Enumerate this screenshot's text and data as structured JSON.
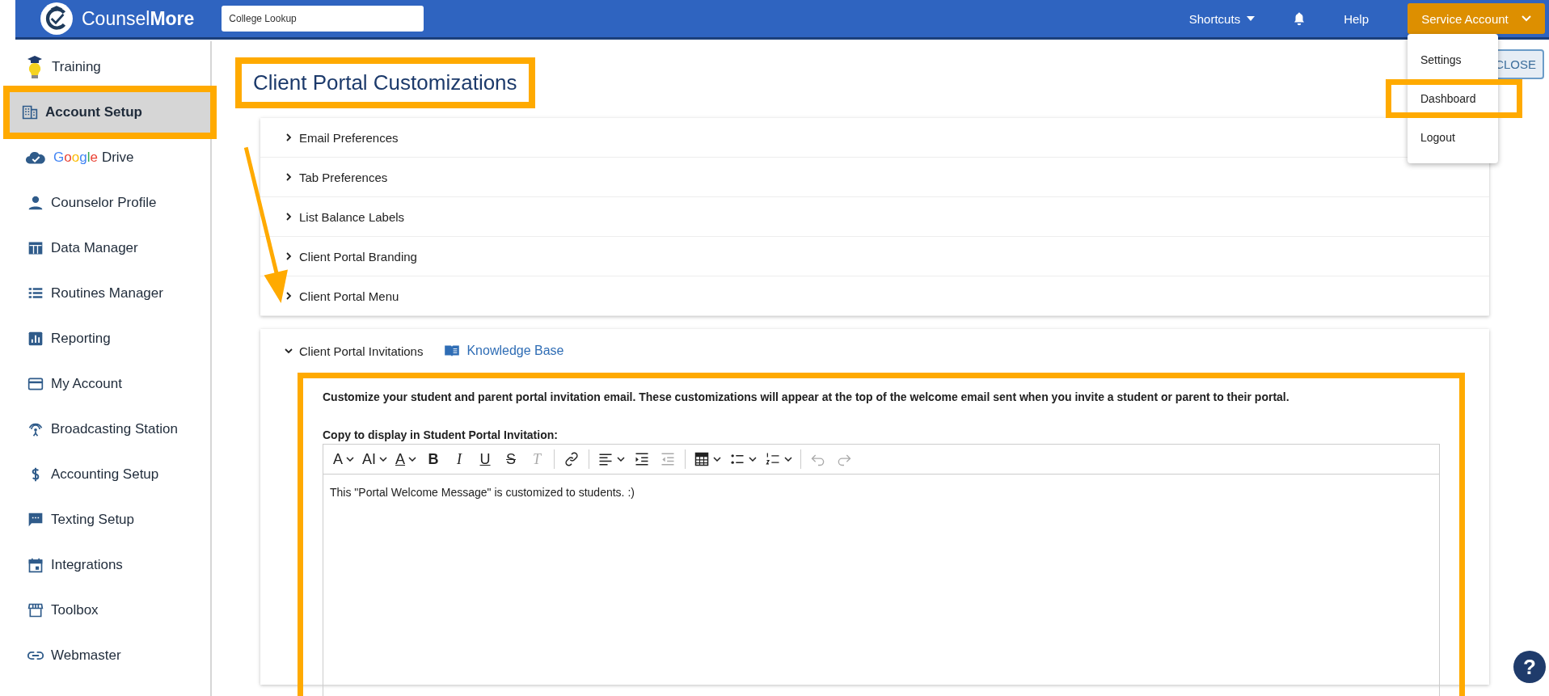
{
  "header": {
    "logo_text": "Counsel**More**",
    "search": {
      "placeholder": "College Lookup"
    },
    "shortcuts": "Shortcuts",
    "help": "Help",
    "account": "Service Account"
  },
  "account_menu": {
    "open": true,
    "items": [
      {
        "label": "Settings",
        "highlighted": false
      },
      {
        "label": "Dashboard",
        "highlighted": true
      },
      {
        "label": "Logout",
        "highlighted": false
      }
    ]
  },
  "sidebar": {
    "items": [
      {
        "label": "Training",
        "selected": false,
        "highlighted": false
      },
      {
        "label": "Account Setup",
        "selected": true,
        "highlighted": true
      },
      {
        "brand": "Google",
        "label": "Drive",
        "selected": false,
        "highlighted": false
      },
      {
        "label": "Counselor Profile",
        "selected": false,
        "highlighted": false
      },
      {
        "label": "Data Manager",
        "selected": false,
        "highlighted": false
      },
      {
        "label": "Routines Manager",
        "selected": false,
        "highlighted": false
      },
      {
        "label": "Reporting",
        "selected": false,
        "highlighted": false
      },
      {
        "label": "My Account",
        "selected": false,
        "highlighted": false
      },
      {
        "label": "Broadcasting Station",
        "selected": false,
        "highlighted": false
      },
      {
        "label": "Accounting Setup",
        "selected": false,
        "highlighted": false
      },
      {
        "label": "Texting Setup",
        "selected": false,
        "highlighted": false
      },
      {
        "label": "Integrations",
        "selected": false,
        "highlighted": false
      },
      {
        "label": "Toolbox",
        "selected": false,
        "highlighted": false
      },
      {
        "label": "Webmaster",
        "selected": false,
        "highlighted": false
      }
    ]
  },
  "page": {
    "title": "Client Portal Customizations",
    "title_highlighted": true,
    "close_button": "CLOSE",
    "sections": [
      {
        "label": "Email Preferences",
        "expanded": false
      },
      {
        "label": "Tab Preferences",
        "expanded": false
      },
      {
        "label": "List Balance Labels",
        "expanded": false
      },
      {
        "label": "Client Portal Branding",
        "expanded": false
      },
      {
        "label": "Client Portal Menu",
        "expanded": false
      }
    ],
    "invitations": {
      "label": "Client Portal Invitations",
      "expanded": true,
      "link": "Knowledge Base",
      "highlighted": true,
      "intro": "Customize your student and parent portal invitation email. These customizations will appear at the top of the welcome email sent when you invite a student or parent to their portal.",
      "editor_label": "Copy to display in Student Portal Invitation:",
      "toolbar": [
        [
          {
            "kind": "font",
            "label": "A",
            "has_menu": true,
            "disabled": false
          },
          {
            "kind": "size",
            "label": "AI",
            "has_menu": true,
            "disabled": false
          },
          {
            "kind": "color",
            "label": "A",
            "has_menu": true,
            "disabled": false
          },
          {
            "kind": "bold",
            "label": "B",
            "has_menu": false,
            "disabled": false
          },
          {
            "kind": "italic",
            "label": "I",
            "has_menu": false,
            "disabled": false
          },
          {
            "kind": "underline",
            "label": "U",
            "has_menu": false,
            "disabled": false
          },
          {
            "kind": "strike",
            "label": "S",
            "has_menu": false,
            "disabled": false
          },
          {
            "kind": "clear",
            "label": "T",
            "has_menu": false,
            "disabled": true
          }
        ],
        [
          {
            "kind": "link",
            "has_menu": false,
            "disabled": false
          }
        ],
        [
          {
            "kind": "align",
            "has_menu": true,
            "disabled": false
          },
          {
            "kind": "indent",
            "has_menu": false,
            "disabled": false
          },
          {
            "kind": "outdent",
            "has_menu": false,
            "disabled": true
          }
        ],
        [
          {
            "kind": "table",
            "has_menu": true,
            "disabled": false
          },
          {
            "kind": "bullets",
            "has_menu": true,
            "disabled": false
          },
          {
            "kind": "numbers",
            "has_menu": true,
            "disabled": false
          }
        ],
        [
          {
            "kind": "undo",
            "has_menu": false,
            "disabled": true
          },
          {
            "kind": "redo",
            "has_menu": false,
            "disabled": true
          }
        ]
      ],
      "content": "This \"Portal Welcome Message\" is customized to students. :)"
    }
  },
  "help_button": "?"
}
